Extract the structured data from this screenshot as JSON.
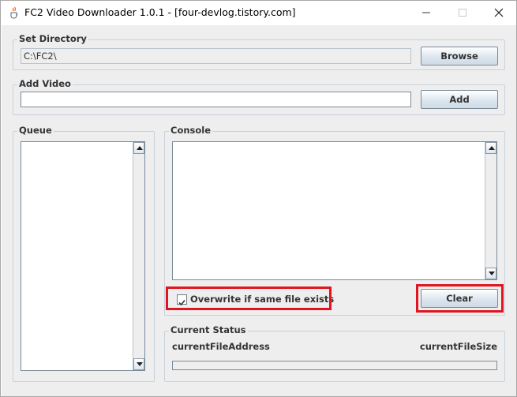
{
  "window": {
    "title": "FC2 Video Downloader 1.0.1 - [four-devlog.tistory.com]"
  },
  "set_directory": {
    "legend": "Set Directory",
    "path_value": "C:\\FC2\\",
    "browse_label": "Browse"
  },
  "add_video": {
    "legend": "Add Video",
    "url_value": "",
    "add_label": "Add"
  },
  "queue": {
    "legend": "Queue"
  },
  "console": {
    "legend": "Console",
    "overwrite_label": "Overwrite if same file exists",
    "overwrite_checked": true,
    "clear_label": "Clear"
  },
  "current_status": {
    "legend": "Current Status",
    "file_address": "currentFileAddress",
    "file_size": "currentFileSize",
    "progress": 0
  },
  "colors": {
    "highlight": "#e0151f",
    "fieldset_border": "#c7d1dc",
    "background": "#eeeeee"
  },
  "icons": {
    "app": "java-cup-icon",
    "minimize": "minimize-icon",
    "maximize": "maximize-icon",
    "close": "close-icon",
    "check": "checkmark-icon",
    "scroll_up": "arrow-up-icon",
    "scroll_down": "arrow-down-icon"
  }
}
